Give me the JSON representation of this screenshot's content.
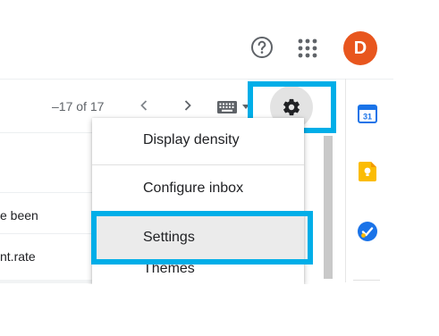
{
  "header": {
    "help_icon": "help-circle-icon",
    "apps_icon": "google-apps-grid-icon",
    "avatar_letter": "D",
    "avatar_color": "#e8561e"
  },
  "toolbar": {
    "page_count": "–17 of 17",
    "prev_icon": "chevron-left-icon",
    "next_icon": "chevron-right-icon",
    "keyboard_icon": "keyboard-icon",
    "settings_icon": "gear-icon"
  },
  "email_list": {
    "rows": [
      {
        "snippet": "e been"
      },
      {
        "snippet": "nt.rate"
      }
    ]
  },
  "menu": {
    "items": [
      {
        "label": "Display density"
      },
      {
        "label": "Configure inbox"
      },
      {
        "label": "Settings"
      },
      {
        "label": "Themes"
      }
    ]
  },
  "side_panel": {
    "calendar_day": "31",
    "calendar_color": "#4285f4",
    "keep_color": "#fbbc04",
    "tasks_color": "#4285f4"
  },
  "highlight_color": "#00aee8"
}
